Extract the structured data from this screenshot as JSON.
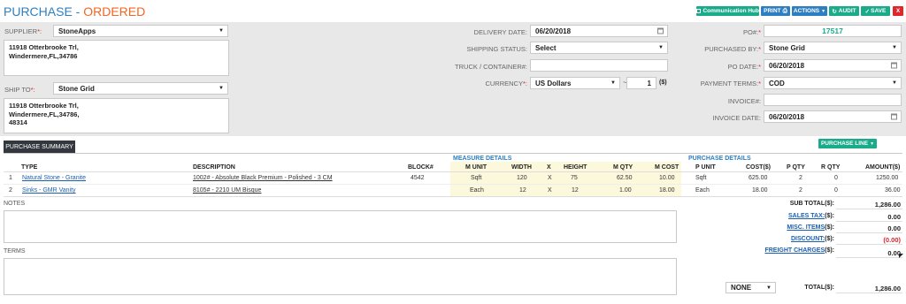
{
  "page": {
    "title_prefix": "PURCHASE - ",
    "title_status": "ORDERED"
  },
  "toolbar": {
    "communication_hub": "Communication Hub",
    "print": "PRINT",
    "actions": "ACTIONS",
    "audit": "AUDIT",
    "save": "SAVE",
    "close": "X"
  },
  "form": {
    "supplier_label": "SUPPLIER",
    "supplier_value": "StoneApps",
    "supplier_address": "11918 Otterbrooke Trl,\nWindermere,FL,34786",
    "ship_to_label": "SHIP TO",
    "ship_to_value": "Stone Grid",
    "ship_to_address": "11918 Otterbrooke Trl,\nWindermere,FL,34786,\n48314",
    "delivery_date_label": "DELIVERY DATE:",
    "delivery_date_value": "06/20/2018",
    "shipping_status_label": "SHIPPING STATUS:",
    "shipping_status_value": "Select",
    "truck_label": "TRUCK / CONTAINER#:",
    "truck_value": "",
    "currency_label": "CURRENCY",
    "currency_value": "US Dollars",
    "rate_value": "1",
    "rate_unit": "($)",
    "po_label": "PO#:",
    "po_value": "17517",
    "purchased_by_label": "PURCHASED BY:",
    "purchased_by_value": "Stone Grid",
    "po_date_label": "PO DATE:",
    "po_date_value": "06/20/2018",
    "payment_terms_label": "PAYMENT TERMS:",
    "payment_terms_value": "COD",
    "invoice_label": "INVOICE#:",
    "invoice_value": "",
    "invoice_date_label": "INVOICE DATE:",
    "invoice_date_value": "06/20/2018"
  },
  "summary": {
    "tab_label": "PURCHASE SUMMARY",
    "purchase_line_button": "PURCHASE LINE",
    "measure_details": "MEASURE DETAILS",
    "purchase_details": "PURCHASE DETAILS",
    "columns": [
      "TYPE",
      "DESCRIPTION",
      "BLOCK#",
      "M UNIT",
      "WIDTH",
      "X",
      "HEIGHT",
      "M QTY",
      "M COST",
      "P UNIT",
      "COST($)",
      "P QTY",
      "R QTY",
      "AMOUNT($)"
    ],
    "rows": [
      {
        "n": "1",
        "type": "Natural Stone - Granite",
        "desc": "1002# - Absolute Black Premium - Polished - 3 CM",
        "block": "4542",
        "munit": "Sqft",
        "width": "120",
        "x": "X",
        "height": "75",
        "mqty": "62.50",
        "mcost": "10.00",
        "punit": "Sqft",
        "cost": "625.00",
        "pqty": "2",
        "rqty": "0",
        "amount": "1250.00"
      },
      {
        "n": "2",
        "type": "Sinks - GMR Vanity",
        "desc": "8105# - 2210 UM Bisque",
        "block": "",
        "munit": "Each",
        "width": "12",
        "x": "X",
        "height": "12",
        "mqty": "1.00",
        "mcost": "18.00",
        "punit": "Each",
        "cost": "18.00",
        "pqty": "2",
        "rqty": "0",
        "amount": "36.00"
      }
    ]
  },
  "notes": {
    "notes_label": "NOTES",
    "terms_label": "TERMS"
  },
  "totals": {
    "sub_total_label": "SUB TOTAL($):",
    "sub_total": "1,286.00",
    "sales_tax_label": "SALES TAX:",
    "sales_tax_suffix": "($):",
    "sales_tax": "0.00",
    "misc_label": "MISC. ITEMS",
    "misc_suffix": "($):",
    "misc": "0.00",
    "discount_label": "DISCOUNT:",
    "discount_suffix": "($):",
    "discount": "(0.00)",
    "freight_label": "FREIGHT CHARGES",
    "freight_suffix": "($):",
    "freight": "0.00",
    "total_select": "NONE",
    "total_label": "TOTAL($):",
    "total": "1,286.00"
  },
  "colors": {
    "accent": "#2d7fc1",
    "status": "#f26522",
    "teal": "#1aab8a",
    "header_bg": "#e8e8e8"
  }
}
